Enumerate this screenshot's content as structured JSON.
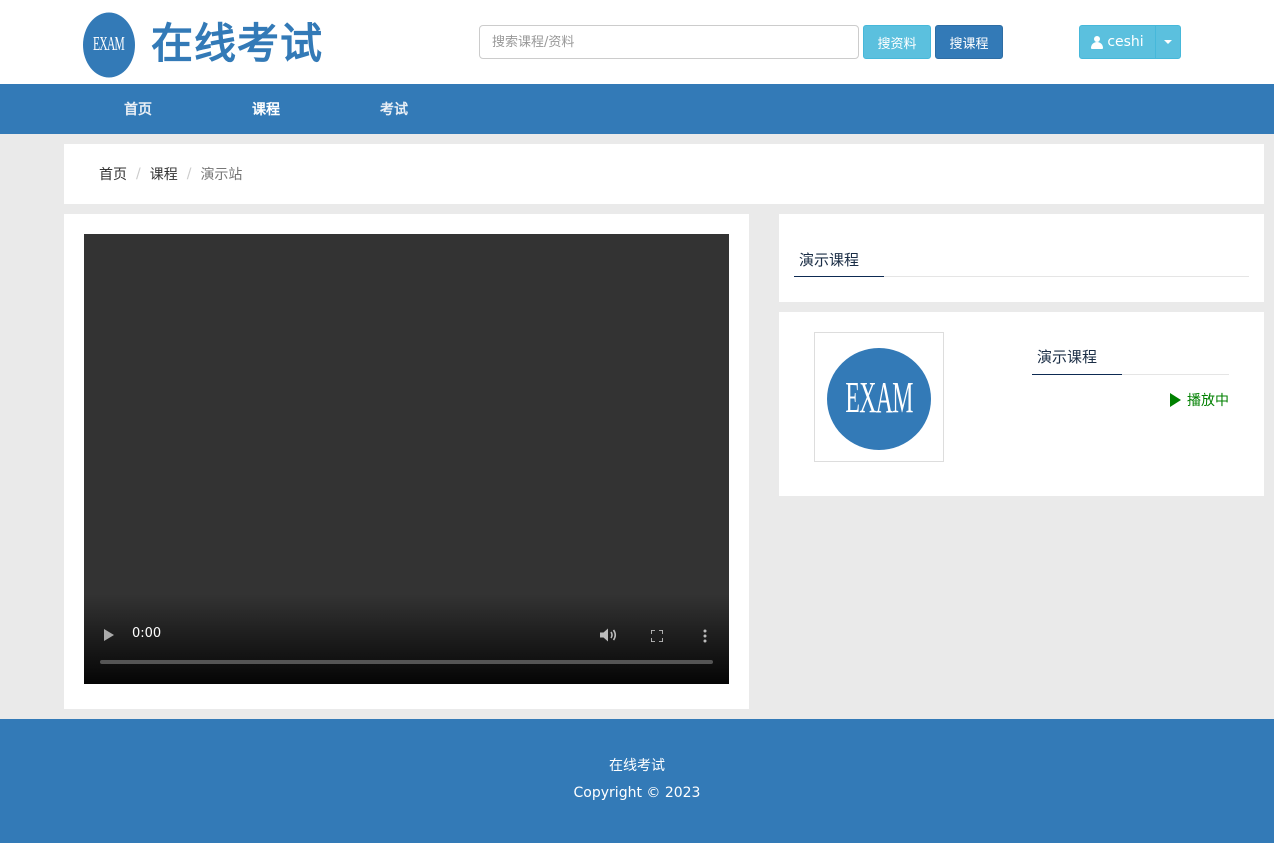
{
  "header": {
    "logo_text": "EXAM",
    "site_title": "在线考试",
    "search_placeholder": "搜索课程/资料",
    "search_material_label": "搜资料",
    "search_course_label": "搜课程",
    "username": "ceshi"
  },
  "nav": {
    "items": [
      {
        "label": "首页"
      },
      {
        "label": "课程"
      },
      {
        "label": "考试"
      }
    ]
  },
  "breadcrumb": {
    "items": [
      "首页",
      "课程",
      "演示站"
    ],
    "separator": "/"
  },
  "video": {
    "current_time": "0:00"
  },
  "course": {
    "title": "演示课程"
  },
  "lesson": {
    "thumbnail_text": "EXAM",
    "title": "演示课程",
    "status": "播放中"
  },
  "footer": {
    "title": "在线考试",
    "copyright": "Copyright © 2023"
  },
  "colors": {
    "primary": "#337ab7",
    "info": "#5bc0de",
    "playing": "#008000",
    "page_background": "#eaeaea"
  },
  "icons": [
    "user-icon",
    "caret-down-icon",
    "play-icon",
    "volume-icon",
    "fullscreen-icon",
    "more-vert-icon",
    "playing-icon"
  ]
}
